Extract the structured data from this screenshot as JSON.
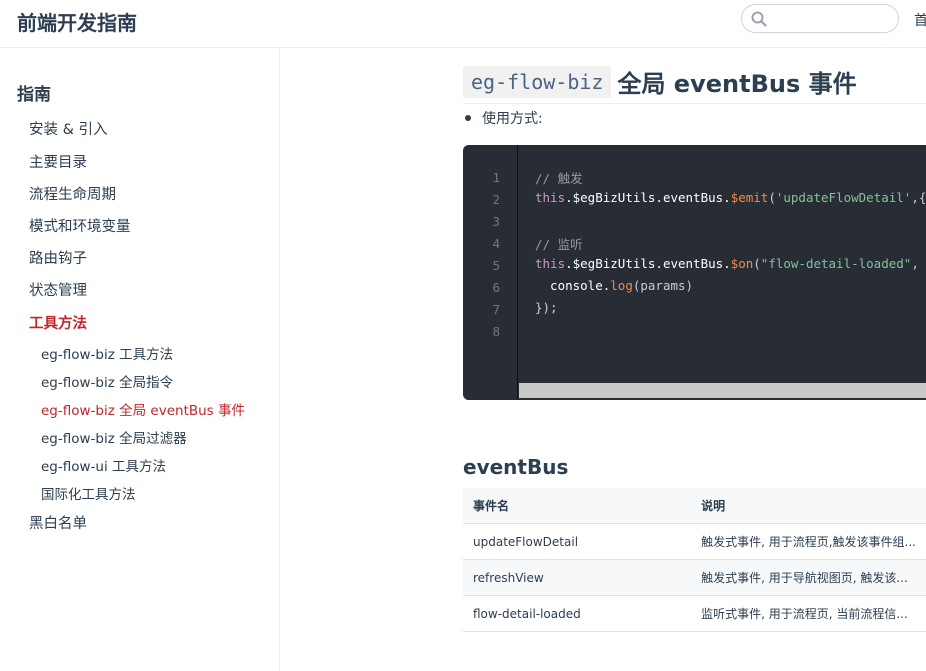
{
  "navbar": {
    "site_name": "前端开发指南",
    "search_placeholder": "",
    "nav_link": "首"
  },
  "sidebar": {
    "heading": "指南",
    "items": [
      {
        "label": "安装 & 引入"
      },
      {
        "label": "主要目录"
      },
      {
        "label": "流程生命周期"
      },
      {
        "label": "模式和环境变量"
      },
      {
        "label": "路由钩子"
      },
      {
        "label": "状态管理"
      },
      {
        "label": "工具方法",
        "active": true
      },
      {
        "label": "黑白名单"
      }
    ],
    "sub_items": [
      {
        "label": "eg-flow-biz 工具方法"
      },
      {
        "label": "eg-flow-biz 全局指令"
      },
      {
        "label": "eg-flow-biz 全局 eventBus 事件",
        "active": true
      },
      {
        "label": "eg-flow-biz 全局过滤器"
      },
      {
        "label": "eg-flow-ui 工具方法"
      },
      {
        "label": "国际化工具方法"
      }
    ]
  },
  "main": {
    "title_code": "eg-flow-biz",
    "title_text": "全局 eventBus 事件",
    "bullet": "使用方式:",
    "code_line_numbers": [
      "1",
      "2",
      "3",
      "4",
      "5",
      "6",
      "7",
      "8"
    ],
    "code": {
      "l1": "// 触发",
      "l2_this": "this",
      "l2_mid": ".$egBizUtils.eventBus.",
      "l2_fn": "$emit",
      "l2_p1": "(",
      "l2_str": "'updateFlowDetail'",
      "l2_p2": ",{",
      "l4": "// 监听",
      "l5_this": "this",
      "l5_mid": ".$egBizUtils.eventBus.",
      "l5_fn": "$on",
      "l5_p1": "(",
      "l5_str": "\"flow-detail-loaded\"",
      "l5_p2": ",",
      "l6_obj": "  console.",
      "l6_fn": "log",
      "l6_rest": "(params)",
      "l7": "});"
    },
    "section_title": "eventBus",
    "table": {
      "headers": [
        "事件名",
        "说明"
      ],
      "rows": [
        [
          "updateFlowDetail",
          "触发式事件, 用于流程页,触发该事件组..."
        ],
        [
          "refreshView",
          "触发式事件, 用于导航视图页, 触发该..."
        ],
        [
          "flow-detail-loaded",
          "监听式事件, 用于流程页, 当前流程信..."
        ]
      ]
    }
  },
  "colors": {
    "accent": "#c0262b",
    "text": "#2c3e50",
    "code_bg": "#282c34"
  }
}
